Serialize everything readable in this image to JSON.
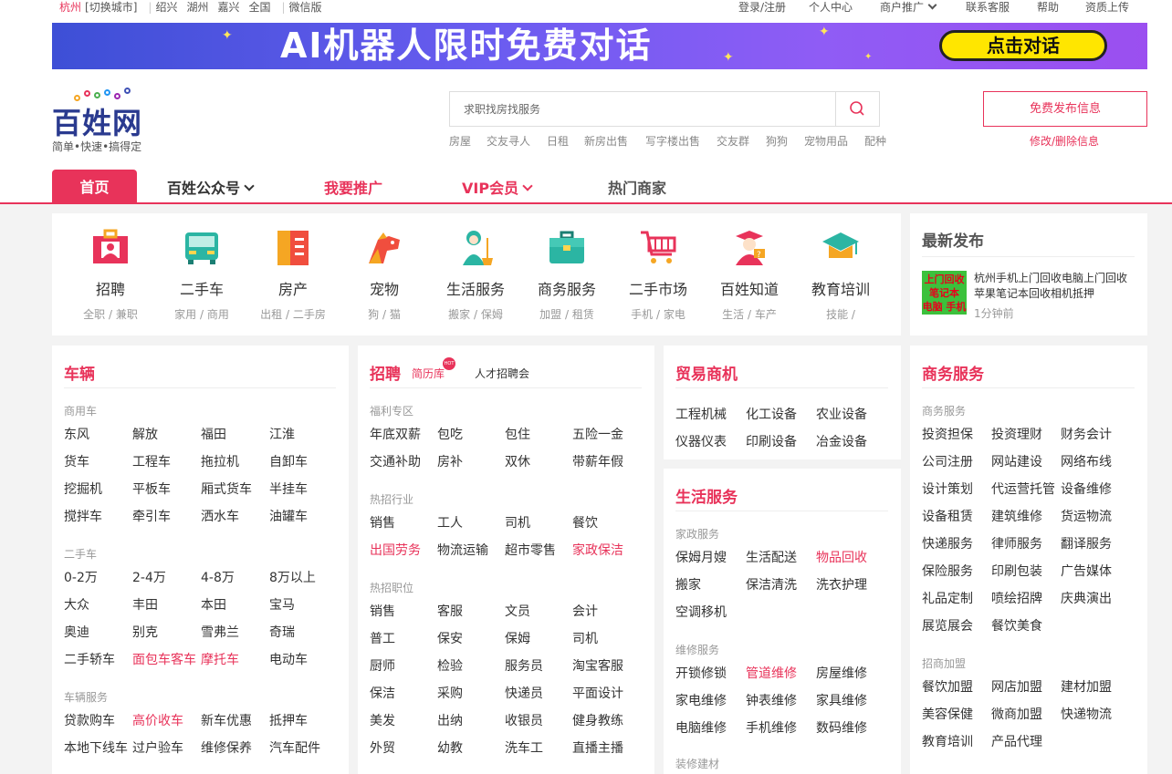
{
  "topbar": {
    "city": "杭州",
    "switch_city": "[切换城市]",
    "nearby": [
      "绍兴",
      "湖州",
      "嘉兴",
      "全国"
    ],
    "wechat": "微信版",
    "right_links": [
      "登录/注册",
      "个人中心",
      "商户推广",
      "联系客服",
      "帮助",
      "资质上传"
    ]
  },
  "banner": {
    "title": "AI机器人限时免费对话",
    "cta": "点击对话"
  },
  "logo": {
    "name": "百姓网",
    "slogan": "简单•快速•搞得定"
  },
  "search": {
    "placeholder": "求职找房找服务",
    "hot_words": [
      "房屋",
      "交友寻人",
      "日租",
      "新房出售",
      "写字楼出售",
      "交友群",
      "狗狗",
      "宠物用品",
      "配种"
    ]
  },
  "publish": {
    "button": "免费发布信息",
    "modify": "修改/删除信息"
  },
  "nav": {
    "home": "首页",
    "items": [
      "百姓公众号",
      "我要推广",
      "VIP会员",
      "热门商家"
    ]
  },
  "categories": [
    {
      "name": "招聘",
      "sub": "全职 / 兼职",
      "icon": "briefcase-person-icon"
    },
    {
      "name": "二手车",
      "sub": "家用 / 商用",
      "icon": "bus-icon"
    },
    {
      "name": "房产",
      "sub": "出租 / 二手房",
      "icon": "building-icon"
    },
    {
      "name": "宠物",
      "sub": "狗 / 猫",
      "icon": "dog-icon"
    },
    {
      "name": "生活服务",
      "sub": "搬家 / 保姆",
      "icon": "cleaner-icon"
    },
    {
      "name": "商务服务",
      "sub": "加盟 / 租赁",
      "icon": "briefcase-icon"
    },
    {
      "name": "二手市场",
      "sub": "手机 / 家电",
      "icon": "cart-icon"
    },
    {
      "name": "百姓知道",
      "sub": "生活 / 车产",
      "icon": "scholar-icon"
    },
    {
      "name": "教育培训",
      "sub": "技能 /",
      "icon": "graduation-cap-icon"
    }
  ],
  "latest": {
    "title": "最新发布",
    "thumb_text": [
      "上门回收",
      "笔记本",
      "电脑 手机"
    ],
    "post_title": "杭州手机上门回收电脑上门回收苹果笔记本回收相机抵押",
    "post_time": "1分钟前"
  },
  "vehicles": {
    "title": "车辆",
    "groups": [
      {
        "label": "商用车",
        "rows": [
          [
            "东风",
            "解放",
            "福田",
            "江淮"
          ],
          [
            "货车",
            "工程车",
            "拖拉机",
            "自卸车"
          ],
          [
            "挖掘机",
            "平板车",
            "厢式货车",
            "半挂车"
          ],
          [
            "搅拌车",
            "牵引车",
            "洒水车",
            "油罐车"
          ]
        ]
      },
      {
        "label": "二手车",
        "rows": [
          [
            "0-2万",
            "2-4万",
            "4-8万",
            "8万以上"
          ],
          [
            "大众",
            "丰田",
            "本田",
            "宝马"
          ],
          [
            "奥迪",
            "别克",
            "雪弗兰",
            "奇瑞"
          ],
          [
            "二手轿车",
            "面包车客车",
            "摩托车",
            "电动车"
          ]
        ]
      },
      {
        "label": "车辆服务",
        "rows": [
          [
            "贷款购车",
            "高价收车",
            "新车优惠",
            "抵押车"
          ],
          [
            "本地下线车",
            "过户验车",
            "维修保养",
            "汽车配件"
          ]
        ]
      }
    ],
    "red": [
      "面包车客车",
      "摩托车",
      "高价收车"
    ]
  },
  "jobs": {
    "title": "招聘",
    "tag1": "简历库",
    "hot_badge": "HOT",
    "tag2": "人才招聘会",
    "groups": [
      {
        "label": "福利专区",
        "rows": [
          [
            "年底双薪",
            "包吃",
            "包住",
            "五险一金"
          ],
          [
            "交通补助",
            "房补",
            "双休",
            "带薪年假"
          ]
        ]
      },
      {
        "label": "热招行业",
        "rows": [
          [
            "销售",
            "工人",
            "司机",
            "餐饮"
          ],
          [
            "出国劳务",
            "物流运输",
            "超市零售",
            "家政保洁"
          ]
        ]
      },
      {
        "label": "热招职位",
        "rows": [
          [
            "销售",
            "客服",
            "文员",
            "会计"
          ],
          [
            "普工",
            "保安",
            "保姆",
            "司机"
          ],
          [
            "厨师",
            "检验",
            "服务员",
            "淘宝客服"
          ],
          [
            "保洁",
            "采购",
            "快递员",
            "平面设计"
          ],
          [
            "美发",
            "出纳",
            "收银员",
            "健身教练"
          ],
          [
            "外贸",
            "幼教",
            "洗车工",
            "直播主播"
          ]
        ]
      }
    ],
    "red": [
      "出国劳务",
      "家政保洁"
    ]
  },
  "trade": {
    "title": "贸易商机",
    "rows": [
      [
        "工程机械",
        "化工设备",
        "农业设备"
      ],
      [
        "仪器仪表",
        "印刷设备",
        "冶金设备"
      ]
    ]
  },
  "life": {
    "title": "生活服务",
    "groups": [
      {
        "label": "家政服务",
        "rows": [
          [
            "保姆月嫂",
            "生活配送",
            "物品回收"
          ],
          [
            "搬家",
            "保洁清洗",
            "洗衣护理"
          ],
          [
            "空调移机"
          ]
        ]
      },
      {
        "label": "维修服务",
        "rows": [
          [
            "开锁修锁",
            "管道维修",
            "房屋维修"
          ],
          [
            "家电维修",
            "钟表维修",
            "家具维修"
          ],
          [
            "电脑维修",
            "手机维修",
            "数码维修"
          ]
        ]
      }
    ],
    "next_group": "装修建材",
    "red": [
      "物品回收",
      "管道维修"
    ]
  },
  "business": {
    "title": "商务服务",
    "groups": [
      {
        "label": "商务服务",
        "rows": [
          [
            "投资担保",
            "投资理财",
            "财务会计"
          ],
          [
            "公司注册",
            "网站建设",
            "网络布线"
          ],
          [
            "设计策划",
            "代运营托管",
            "设备维修"
          ],
          [
            "设备租赁",
            "建筑维修",
            "货运物流"
          ],
          [
            "快递服务",
            "律师服务",
            "翻译服务"
          ],
          [
            "保险服务",
            "印刷包装",
            "广告媒体"
          ],
          [
            "礼品定制",
            "喷绘招牌",
            "庆典演出"
          ],
          [
            "展览展会",
            "餐饮美食"
          ]
        ]
      },
      {
        "label": "招商加盟",
        "rows": [
          [
            "餐饮加盟",
            "网店加盟",
            "建材加盟"
          ],
          [
            "美容保健",
            "微商加盟",
            "快递物流"
          ],
          [
            "教育培训",
            "产品代理"
          ]
        ]
      }
    ]
  },
  "colors": {
    "accent": "#e8335a",
    "logo_blue": "#2a3a8f",
    "page_bg": "#f3f3f3"
  }
}
